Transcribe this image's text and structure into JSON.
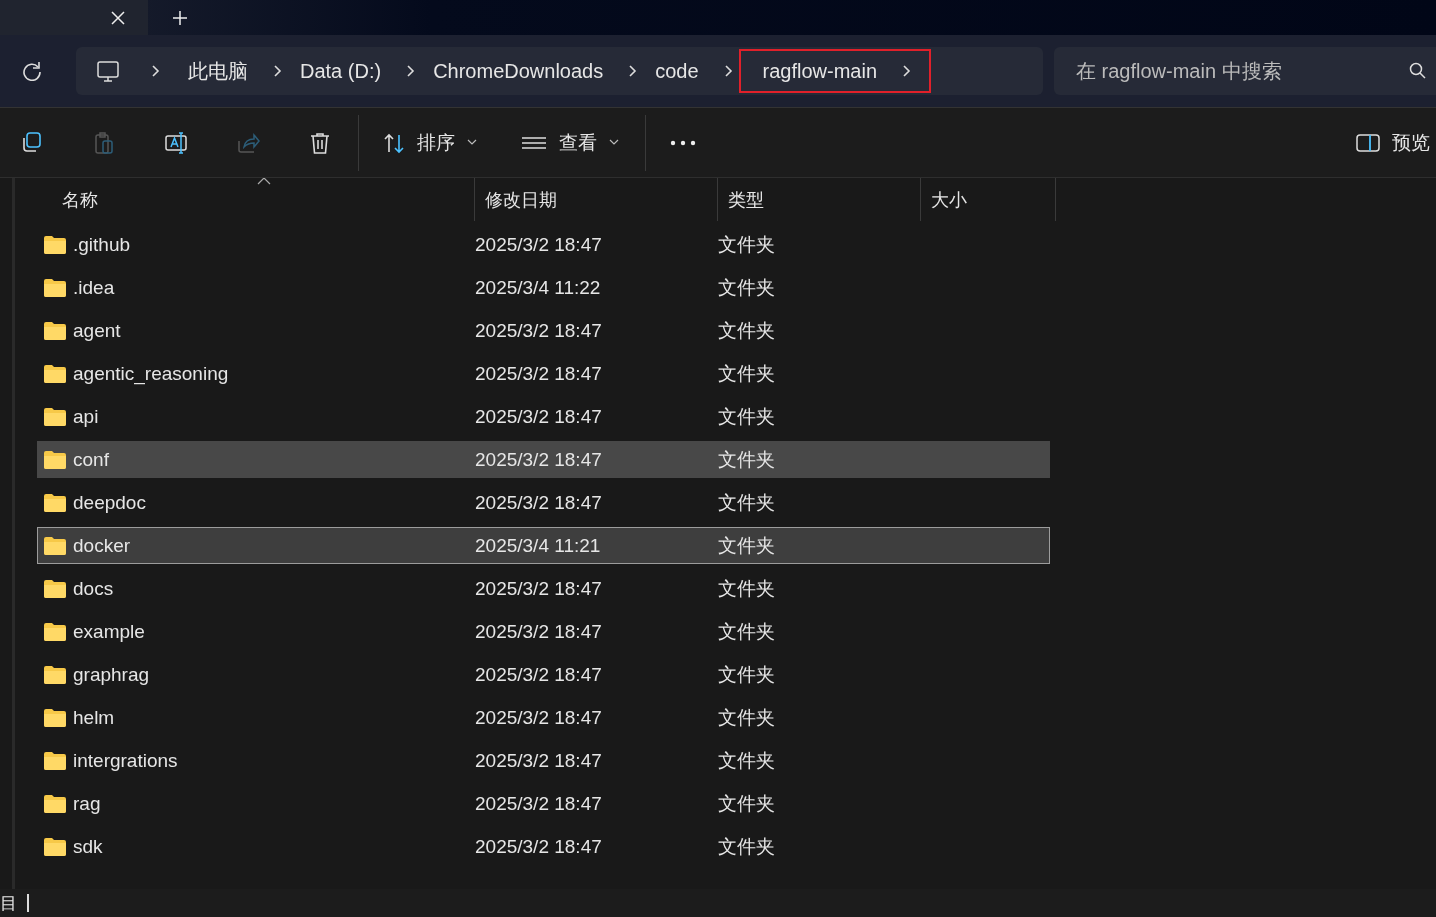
{
  "address_bar": {
    "breadcrumbs": [
      {
        "label": "此电脑",
        "highlighted": false
      },
      {
        "label": "Data (D:)",
        "highlighted": false
      },
      {
        "label": "ChromeDownloads",
        "highlighted": false
      },
      {
        "label": "code",
        "highlighted": false
      },
      {
        "label": "ragflow-main",
        "highlighted": true
      }
    ],
    "search": {
      "placeholder": "在 ragflow-main 中搜索"
    }
  },
  "toolbar": {
    "buttons": [
      {
        "kind": "copy",
        "disabled": false
      },
      {
        "kind": "paste",
        "disabled": true
      },
      {
        "kind": "rename",
        "disabled": false
      },
      {
        "kind": "share",
        "disabled": true
      },
      {
        "kind": "delete",
        "disabled": false
      }
    ],
    "sort": {
      "label": "排序"
    },
    "view": {
      "label": "查看"
    },
    "preview": {
      "label": "预览"
    }
  },
  "table": {
    "columns": [
      {
        "label": "名称",
        "sorted": true
      },
      {
        "label": "修改日期",
        "sorted": false
      },
      {
        "label": "类型",
        "sorted": false
      },
      {
        "label": "大小",
        "sorted": false
      }
    ],
    "rows": [
      {
        "name": ".github",
        "date": "2025/3/2 18:47",
        "type": "文件夹",
        "selected": false,
        "focused": false
      },
      {
        "name": ".idea",
        "date": "2025/3/4 11:22",
        "type": "文件夹",
        "selected": false,
        "focused": false
      },
      {
        "name": "agent",
        "date": "2025/3/2 18:47",
        "type": "文件夹",
        "selected": false,
        "focused": false
      },
      {
        "name": "agentic_reasoning",
        "date": "2025/3/2 18:47",
        "type": "文件夹",
        "selected": false,
        "focused": false
      },
      {
        "name": "api",
        "date": "2025/3/2 18:47",
        "type": "文件夹",
        "selected": false,
        "focused": false
      },
      {
        "name": "conf",
        "date": "2025/3/2 18:47",
        "type": "文件夹",
        "selected": true,
        "focused": false
      },
      {
        "name": "deepdoc",
        "date": "2025/3/2 18:47",
        "type": "文件夹",
        "selected": false,
        "focused": false
      },
      {
        "name": "docker",
        "date": "2025/3/4 11:21",
        "type": "文件夹",
        "selected": true,
        "focused": true
      },
      {
        "name": "docs",
        "date": "2025/3/2 18:47",
        "type": "文件夹",
        "selected": false,
        "focused": false
      },
      {
        "name": "example",
        "date": "2025/3/2 18:47",
        "type": "文件夹",
        "selected": false,
        "focused": false
      },
      {
        "name": "graphrag",
        "date": "2025/3/2 18:47",
        "type": "文件夹",
        "selected": false,
        "focused": false
      },
      {
        "name": "helm",
        "date": "2025/3/2 18:47",
        "type": "文件夹",
        "selected": false,
        "focused": false
      },
      {
        "name": "intergrations",
        "date": "2025/3/2 18:47",
        "type": "文件夹",
        "selected": false,
        "focused": false
      },
      {
        "name": "rag",
        "date": "2025/3/2 18:47",
        "type": "文件夹",
        "selected": false,
        "focused": false
      },
      {
        "name": "sdk",
        "date": "2025/3/2 18:47",
        "type": "文件夹",
        "selected": false,
        "focused": false
      }
    ]
  },
  "status_bar": {
    "text": "目"
  }
}
